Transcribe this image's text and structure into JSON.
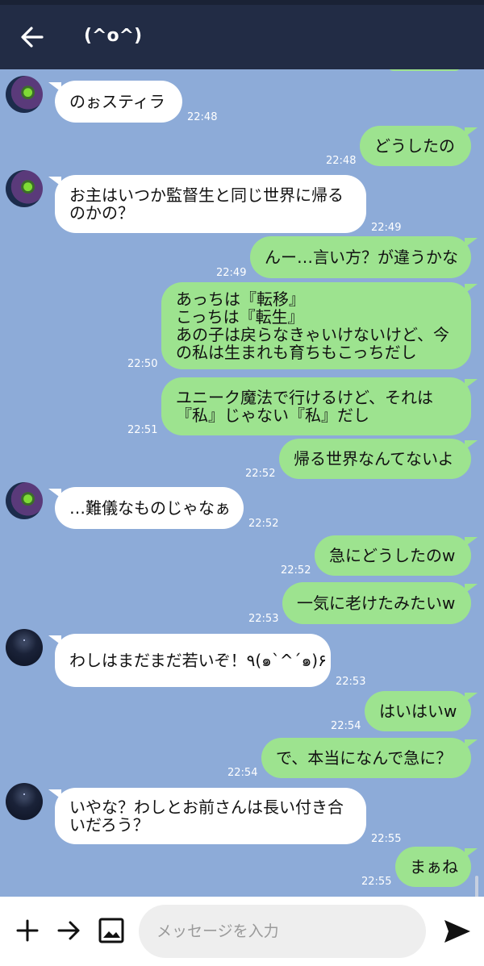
{
  "header": {
    "title": "(^o^)"
  },
  "messages": [
    {
      "side": "in",
      "avatar": "a",
      "text": "のぉスティラ",
      "time": "22:48"
    },
    {
      "side": "out",
      "text": "どうしたの",
      "time": "22:48"
    },
    {
      "side": "in",
      "avatar": "a",
      "text": "お主はいつか監督生と同じ世界に帰る\nのかの？",
      "time": "22:49"
    },
    {
      "side": "out",
      "text": "んー…言い方？が違うかな",
      "time": "22:49"
    },
    {
      "side": "out",
      "text": "あっちは『転移』\nこっちは『転生』\nあの子は戻らなきゃいけないけど、今\nの私は生まれも育ちもこっちだし",
      "time": "22:50"
    },
    {
      "side": "out",
      "text": "ユニーク魔法で行けるけど、それは\n『私』じゃない『私』だし",
      "time": "22:51"
    },
    {
      "side": "out",
      "text": "帰る世界なんてないよ",
      "time": "22:52"
    },
    {
      "side": "in",
      "avatar": "a",
      "text": "…難儀なものじゃなぁ",
      "time": "22:52"
    },
    {
      "side": "out",
      "text": "急にどうしたのw",
      "time": "22:52"
    },
    {
      "side": "out",
      "text": "一気に老けたみたいw",
      "time": "22:53"
    },
    {
      "side": "in",
      "avatar": "b",
      "text": "わしはまだまだ若いぞ！٩(๑`^´๑)۶",
      "time": "22:53"
    },
    {
      "side": "out",
      "text": "はいはいw",
      "time": "22:54"
    },
    {
      "side": "out",
      "text": "で、本当になんで急に？",
      "time": "22:54"
    },
    {
      "side": "in",
      "avatar": "b",
      "text": "いやな？わしとお前さんは長い付き合\nいだろう？",
      "time": "22:55"
    },
    {
      "side": "out",
      "text": "まぁね",
      "time": "22:55"
    }
  ],
  "input": {
    "placeholder": "メッセージを入力"
  },
  "icons": {
    "back": "arrow-left-icon",
    "plus": "plus-icon",
    "forward": "arrow-right-icon",
    "image": "image-icon",
    "send": "send-icon"
  },
  "colors": {
    "header_bg": "#222c45",
    "chat_bg": "#8dabd8",
    "incoming_bubble": "#ffffff",
    "outgoing_bubble": "#9de38f"
  }
}
